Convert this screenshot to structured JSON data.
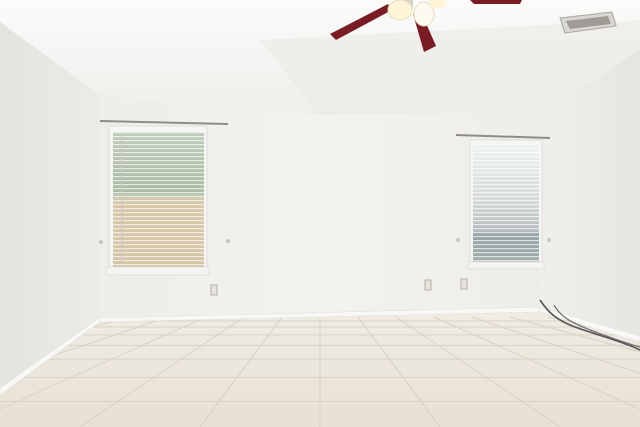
{
  "scene": {
    "kind": "photo",
    "colors": {
      "ceiling": "#f4f3f1",
      "wall_back": "#f1f0ed",
      "wall_left": "#e9e8e5",
      "wall_right": "#ecebe8",
      "floor": "#ece6dc",
      "grout": "#d8d0c4",
      "baseboard": "#f7f7f5",
      "fan_blade": "#7a1c24",
      "fan_light": "#fff6d8",
      "window_blind": "#f4f4f2",
      "tree_green": "#8da085",
      "fence_tan": "#d8c7a8"
    },
    "objects": [
      "ceiling-fan",
      "left-window",
      "right-window",
      "air-vent",
      "electrical-outlets",
      "tile-floor",
      "cable"
    ]
  }
}
